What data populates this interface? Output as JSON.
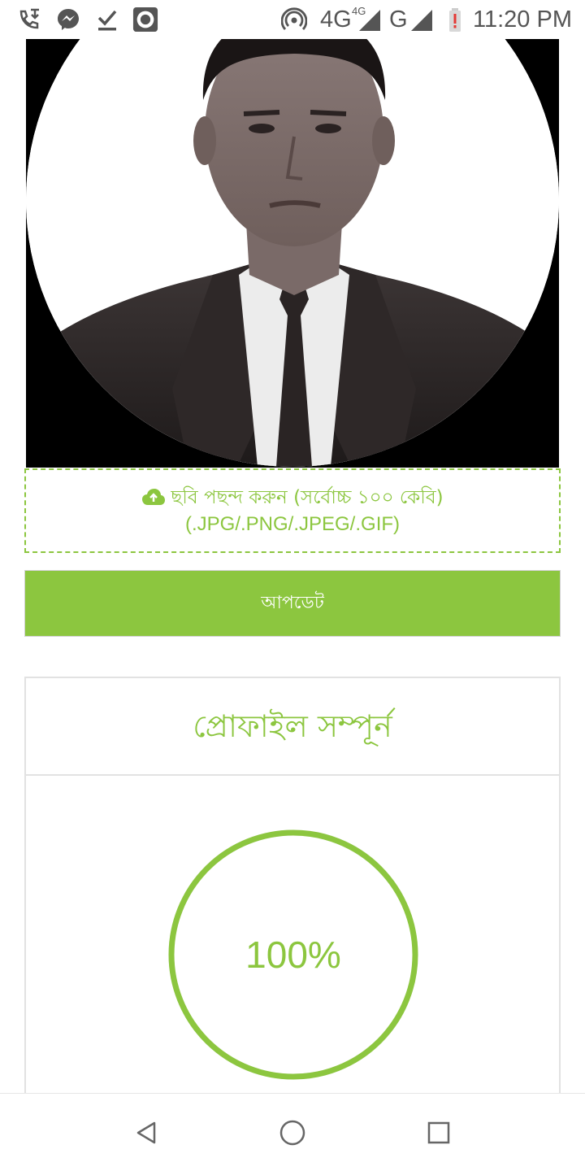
{
  "status_bar": {
    "time": "11:20 PM",
    "network_type": "4G",
    "network_type_small": "4G",
    "secondary_network": "G",
    "icons": [
      "wifi-call-icon",
      "messenger-icon",
      "download-done-icon",
      "camera-app-icon",
      "hotspot-icon",
      "signal-icon",
      "battery-low-icon"
    ]
  },
  "profile_photo": {
    "alt_icon": "profile-portrait"
  },
  "upload": {
    "icon": "cloud-upload-icon",
    "label": "ছবি পছন্দ করুন (সর্বোচ্চ ১০০ কেবি)",
    "formats": "(.JPG/.PNG/.JPEG/.GIF)"
  },
  "update_button": {
    "label": "আপডেট"
  },
  "profile_panel": {
    "title": "প্রোফাইল সম্পূর্ন",
    "progress_text": "100%",
    "progress_value": 1.0
  },
  "colors": {
    "accent": "#8cc63f",
    "border": "#e2e2e2",
    "status_text": "#555555"
  },
  "nav_bar": {
    "icons": [
      "back-icon",
      "home-icon",
      "recents-icon"
    ]
  }
}
